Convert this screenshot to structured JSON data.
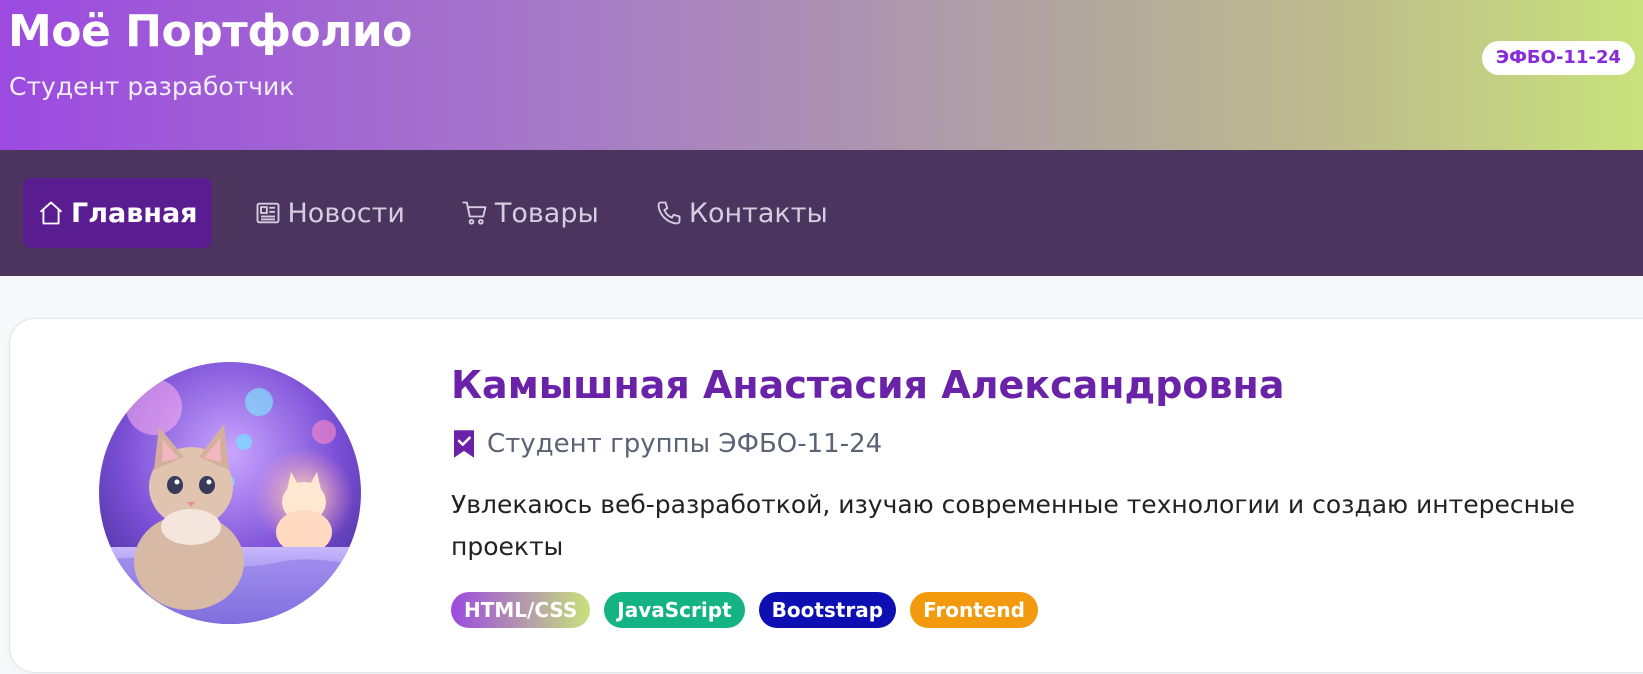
{
  "header": {
    "title": "Моё Портфолио",
    "subtitle": "Студент разработчик",
    "badge": "ЭФБО-11-24"
  },
  "nav": {
    "items": [
      {
        "label": "Главная",
        "icon": "home-icon",
        "active": true
      },
      {
        "label": "Новости",
        "icon": "newspaper-icon",
        "active": false
      },
      {
        "label": "Товары",
        "icon": "cart-icon",
        "active": false
      },
      {
        "label": "Контакты",
        "icon": "phone-icon",
        "active": false
      }
    ]
  },
  "profile": {
    "name": "Камышная Анастасия Александровна",
    "group": "Студент группы ЭФБО-11-24",
    "bio": "Увлекаюсь веб-разработкой, изучаю современные технологии и создаю интересные проекты",
    "avatar_icon": "cat-avatar-image",
    "tags": [
      {
        "label": "HTML/CSS",
        "color": "gradient"
      },
      {
        "label": "JavaScript",
        "color": "#13b383"
      },
      {
        "label": "Bootstrap",
        "color": "#0d0fb3"
      },
      {
        "label": "Frontend",
        "color": "#f2990d"
      }
    ]
  },
  "colors": {
    "accent": "#6a22a8",
    "nav_bg": "#4b355f",
    "nav_active": "#5a1d91"
  }
}
